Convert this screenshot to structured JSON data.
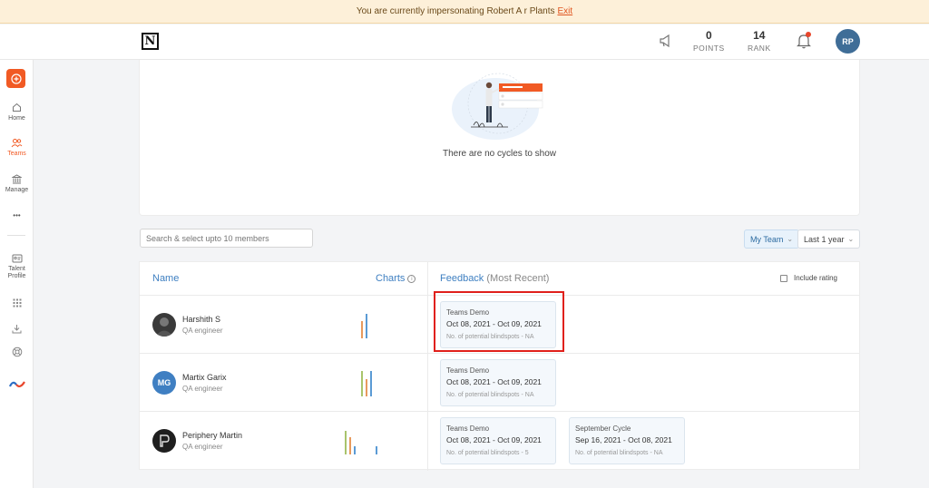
{
  "banner": {
    "text": "You are currently impersonating Robert A r Plants",
    "link": "Exit"
  },
  "header": {
    "logo": "N",
    "points_value": "0",
    "points_label": "POINTS",
    "rank_value": "14",
    "rank_label": "RANK",
    "avatar": "RP"
  },
  "sidebar": {
    "home": "Home",
    "teams": "Teams",
    "manage": "Manage",
    "more": "•••",
    "talent_line1": "Talent",
    "talent_line2": "Profile"
  },
  "cycles": {
    "empty_text": "There are no cycles to show"
  },
  "filters": {
    "search_placeholder": "Search & select upto 10 members",
    "team": "My Team",
    "period": "Last 1 year"
  },
  "table": {
    "col_name": "Name",
    "col_charts": "Charts",
    "col_feedback": "Feedback",
    "col_feedback_sub": "(Most Recent)",
    "include_rating": "Include rating",
    "rows": [
      {
        "name": "Harshith S",
        "role": "QA engineer",
        "initials": "",
        "cards": [
          {
            "title": "Teams Demo",
            "dates": "Oct 08, 2021 - Oct 09, 2021",
            "blindspots": "No. of potential blindspots - NA"
          }
        ]
      },
      {
        "name": "Martix Garix",
        "role": "QA engineer",
        "initials": "MG",
        "cards": [
          {
            "title": "Teams Demo",
            "dates": "Oct 08, 2021 - Oct 09, 2021",
            "blindspots": "No. of potential blindspots - NA"
          }
        ]
      },
      {
        "name": "Periphery Martin",
        "role": "QA engineer",
        "initials": "",
        "cards": [
          {
            "title": "Teams Demo",
            "dates": "Oct 08, 2021 - Oct 09, 2021",
            "blindspots": "No. of potential blindspots - 5"
          },
          {
            "title": "September Cycle",
            "dates": "Sep 16, 2021 - Oct 08, 2021",
            "blindspots": "No. of potential blindspots - NA"
          }
        ]
      }
    ]
  },
  "colors": {
    "accent": "#f15a24",
    "link_blue": "#3e7fc1",
    "avatar_blue": "#3f6d97",
    "highlight": "#e0201b"
  }
}
